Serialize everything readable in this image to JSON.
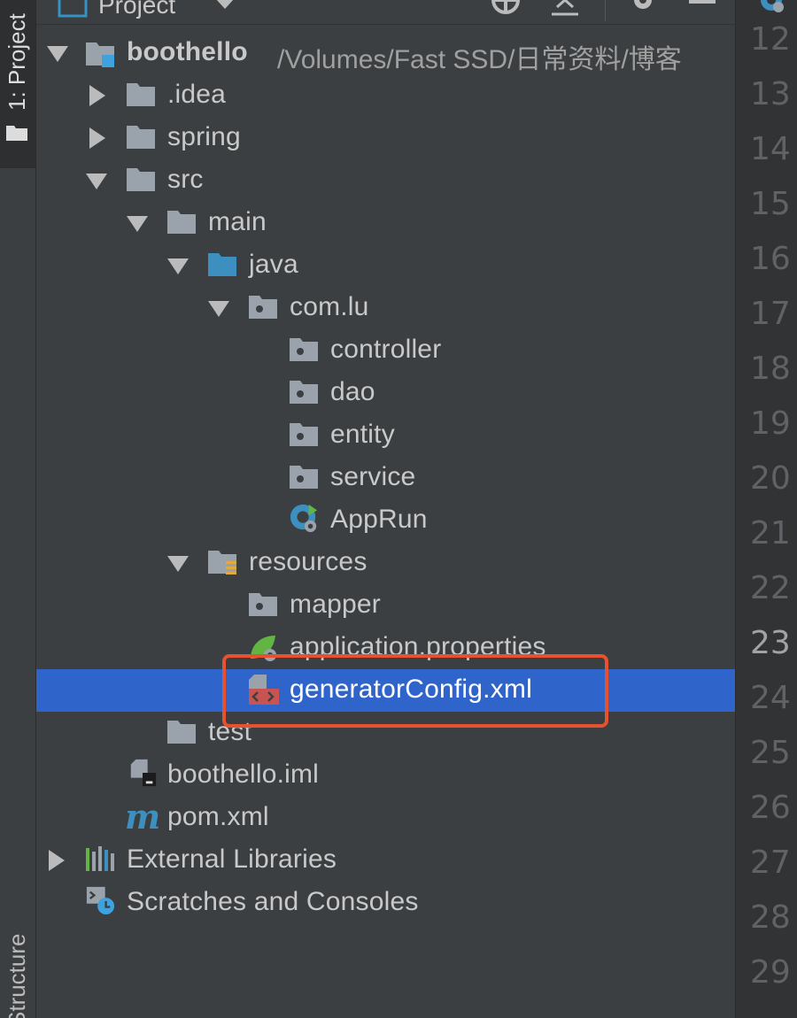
{
  "side_strip": {
    "project_tab": "1: Project",
    "structure_tab": "Structure"
  },
  "header": {
    "title": "Project"
  },
  "tree": {
    "root_label": "boothello",
    "root_path": "/Volumes/Fast SSD/日常资料/博客",
    "items": [
      {
        "label": "boothello"
      },
      {
        "label": ".idea"
      },
      {
        "label": "spring"
      },
      {
        "label": "src"
      },
      {
        "label": "main"
      },
      {
        "label": "java"
      },
      {
        "label": "com.lu"
      },
      {
        "label": "controller"
      },
      {
        "label": "dao"
      },
      {
        "label": "entity"
      },
      {
        "label": "service"
      },
      {
        "label": "AppRun"
      },
      {
        "label": "resources"
      },
      {
        "label": "mapper"
      },
      {
        "label": "application.properties"
      },
      {
        "label": "generatorConfig.xml"
      },
      {
        "label": "test"
      },
      {
        "label": "boothello.iml"
      },
      {
        "label": "pom.xml"
      },
      {
        "label": "External Libraries"
      },
      {
        "label": "Scratches and Consoles"
      }
    ]
  },
  "gutter": {
    "lines": [
      "12",
      "13",
      "14",
      "15",
      "16",
      "17",
      "18",
      "19",
      "20",
      "21",
      "22",
      "23",
      "24",
      "25",
      "26",
      "27",
      "28",
      "29"
    ],
    "current": "23"
  },
  "colors": {
    "selection": "#2f65ca",
    "highlight_box": "#e8512f",
    "background": "#3c3f41",
    "gutter": "#313335"
  }
}
